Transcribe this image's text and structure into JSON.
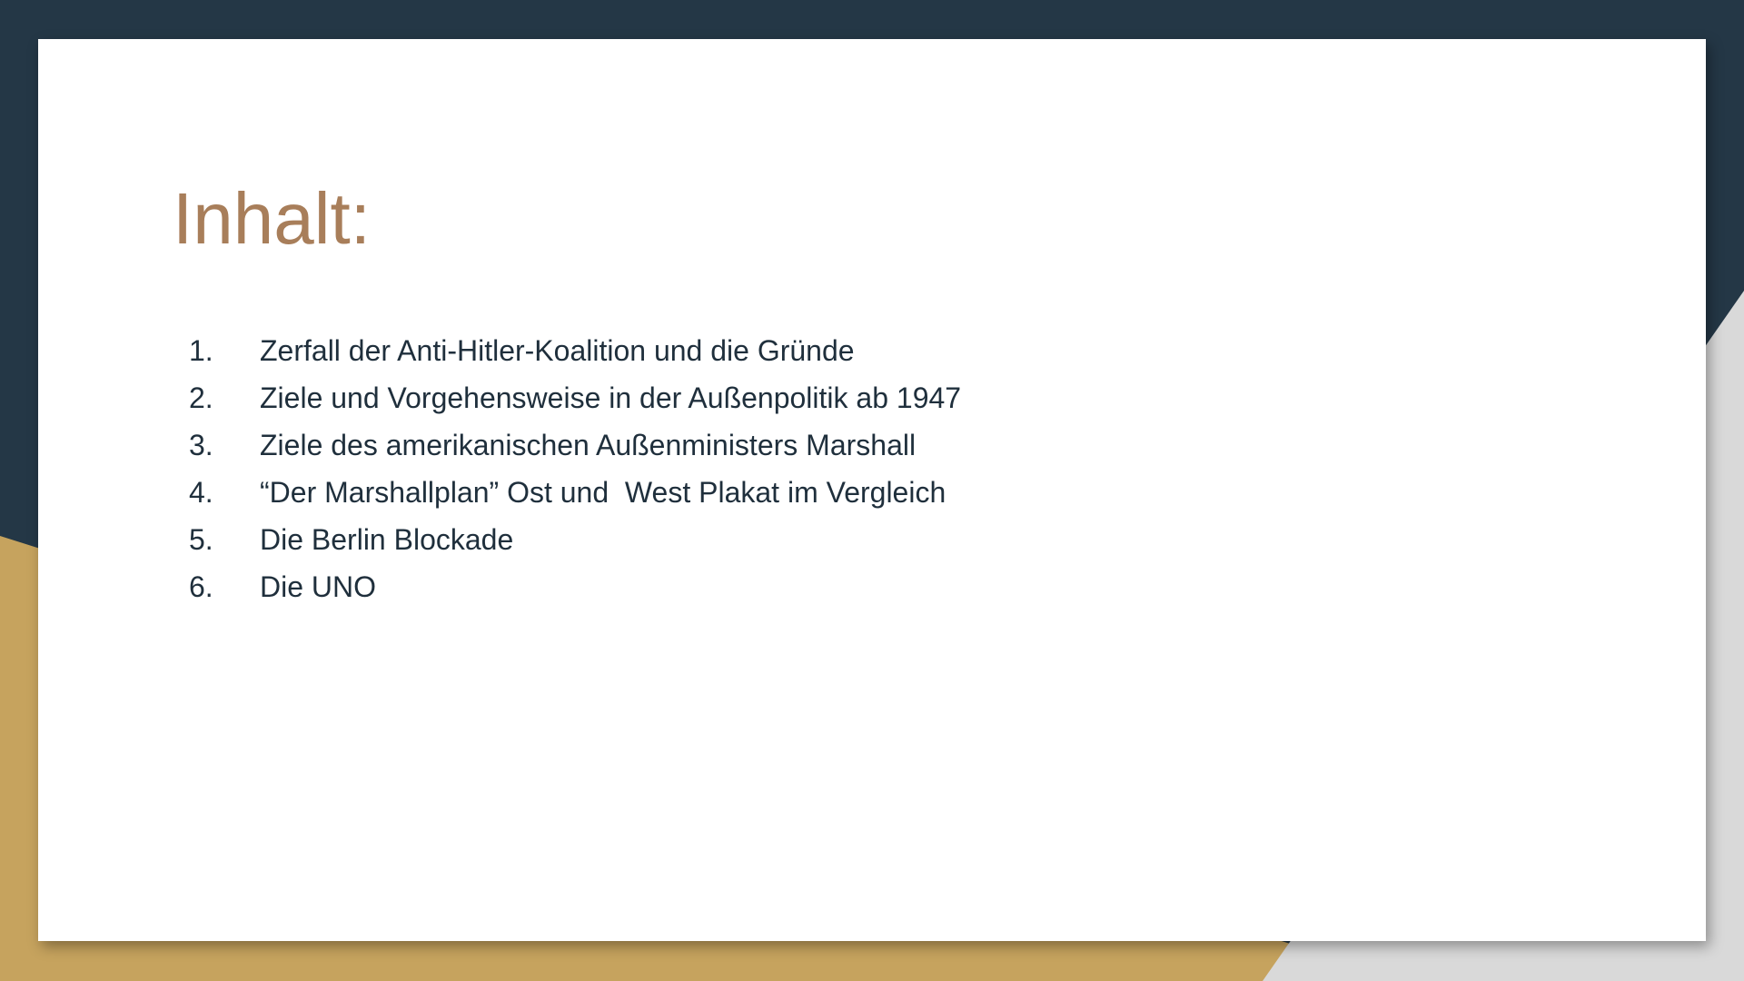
{
  "slide": {
    "title": "Inhalt:",
    "items": [
      {
        "number": "1.",
        "text": "Zerfall der Anti-Hitler-Koalition und die Gründe"
      },
      {
        "number": "2.",
        "text": "Ziele und Vorgehensweise in der Außenpolitik ab 1947"
      },
      {
        "number": "3.",
        "text": "Ziele des amerikanischen Außenministers Marshall"
      },
      {
        "number": "4.",
        "text": "“Der Marshallplan” Ost und  West Plakat im Vergleich"
      },
      {
        "number": "5.",
        "text": "Die Berlin Blockade"
      },
      {
        "number": "6.",
        "text": "Die UNO"
      }
    ]
  },
  "colors": {
    "background_dark": "#243746",
    "background_gold": "#c6a35e",
    "background_grey": "#d9d9d9",
    "title": "#a87e5a",
    "text": "#1f2f3c"
  }
}
